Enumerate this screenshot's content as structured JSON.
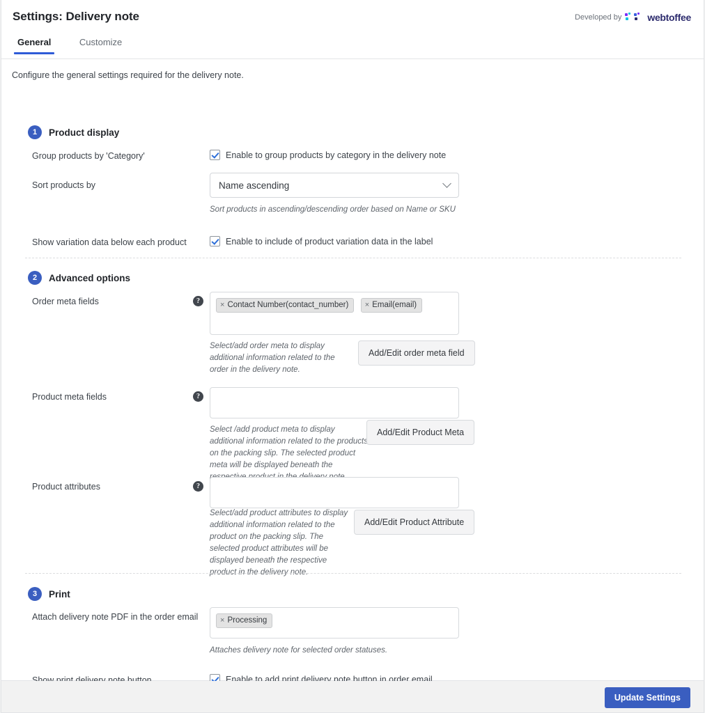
{
  "header": {
    "title": "Settings: Delivery note",
    "developed_by": "Developed by",
    "brand_name": "webtoffee",
    "brand_color": "#2d2c6e",
    "mark_colors": [
      "#7b2ff7",
      "#00c2e0",
      "#3b5fe0",
      "#2d2c6e"
    ]
  },
  "tabs": [
    {
      "label": "General",
      "active": true
    },
    {
      "label": "Customize",
      "active": false
    }
  ],
  "intro": "Configure the general settings required for the delivery note.",
  "accent_color": "#3a5ec0",
  "sections": [
    {
      "number": "1",
      "title": "Product display",
      "rows": [
        {
          "label": "Group products by 'Category'",
          "control": "checkbox",
          "checked": true,
          "checkbox_label": "Enable to group products by category in the delivery note"
        },
        {
          "label": "Sort products by",
          "control": "select",
          "value": "Name ascending",
          "hint": "Sort products in ascending/descending order based on Name or SKU"
        },
        {
          "label": "Show variation data below each product",
          "control": "checkbox",
          "checked": true,
          "checkbox_label": "Enable to include of product variation data in the label"
        }
      ]
    },
    {
      "number": "2",
      "title": "Advanced options",
      "rows": [
        {
          "label": "Order meta fields",
          "control": "tokens",
          "help": "?",
          "tokens": [
            "Contact Number(contact_number)",
            "Email(email)"
          ],
          "hint": "Select/add order meta to display additional information related to the order in the delivery note.",
          "button": "Add/Edit order meta field"
        },
        {
          "label": "Product meta fields",
          "control": "tokens",
          "help": "?",
          "tokens": [],
          "hint": "Select /add product meta to display additional information related to the products on the packing slip. The selected product meta will be displayed beneath the respective product in the delivery note.",
          "button": "Add/Edit Product Meta"
        },
        {
          "label": "Product attributes",
          "control": "tokens",
          "help": "?",
          "tokens": [],
          "hint": "Select/add product attributes to display additional information related to the product on the packing slip. The selected product attributes will be displayed beneath the respective product in the delivery note.",
          "button": "Add/Edit Product Attribute"
        }
      ]
    },
    {
      "number": "3",
      "title": "Print",
      "rows": [
        {
          "label": "Attach delivery note PDF in the order email",
          "control": "tokens",
          "tokens": [
            "Processing"
          ],
          "hint": "Attaches delivery note for selected order statuses."
        },
        {
          "label": "Show print delivery note button",
          "control": "checkbox",
          "checked": true,
          "checkbox_label": "Enable to add print delivery note button in order email"
        }
      ]
    }
  ],
  "footer": {
    "update_label": "Update Settings"
  }
}
